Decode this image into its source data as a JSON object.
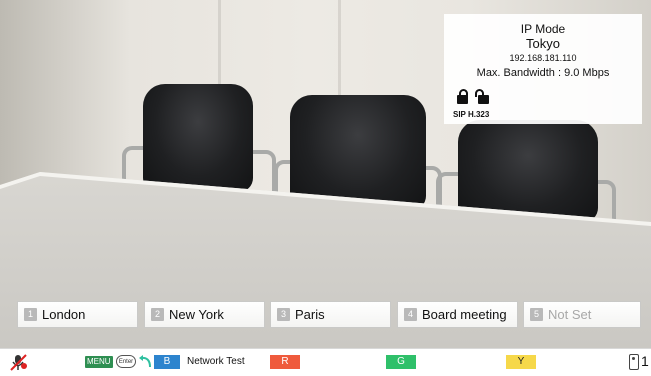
{
  "info": {
    "mode": "IP Mode",
    "site": "Tokyo",
    "ip": "192.168.181.110",
    "bandwidth": "Max. Bandwidth : 9.0 Mbps",
    "protocols": "SIP H.323"
  },
  "sites": [
    {
      "num": "1",
      "label": "London"
    },
    {
      "num": "2",
      "label": "New York"
    },
    {
      "num": "3",
      "label": "Paris"
    },
    {
      "num": "4",
      "label": "Board meeting"
    },
    {
      "num": "5",
      "label": "Not Set"
    }
  ],
  "status": {
    "menu_key": "MENU",
    "enter_key": "Enter",
    "b_key": "B",
    "b_label": "Network Test",
    "r_key": "R",
    "g_key": "G",
    "y_key": "Y",
    "page": "1"
  }
}
